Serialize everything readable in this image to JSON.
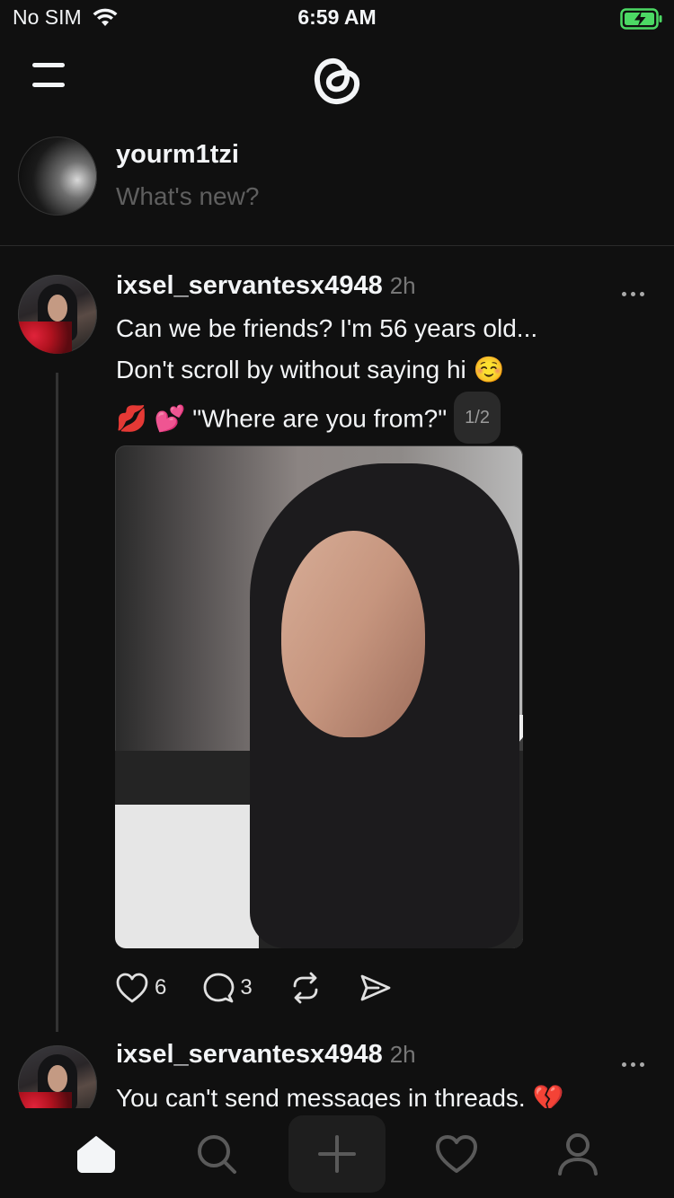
{
  "status_bar": {
    "carrier": "No SIM",
    "time": "6:59 AM"
  },
  "composer": {
    "username": "yourm1tzi",
    "placeholder": "What's new?"
  },
  "posts": [
    {
      "username": "ixsel_servantesx4948",
      "time": "2h",
      "line1": "Can we be friends? I'm 56 years old...",
      "line2": "Don't scroll by without saying hi ☺️",
      "line3": "💋  💕  \"Where are you from?\"",
      "page_indicator": "1/2",
      "likes": "6",
      "replies": "3"
    },
    {
      "username": "ixsel_servantesx4948",
      "time": "2h",
      "line1": "You can't send messages in threads. 💔"
    }
  ],
  "colors": {
    "background": "#101010",
    "text": "#f3f5f7",
    "muted": "#777777",
    "battery": "#4cd964"
  },
  "icons": {
    "header": [
      "menu-icon",
      "threads-logo"
    ],
    "actions": [
      "heart-icon",
      "comment-icon",
      "repost-icon",
      "share-icon"
    ],
    "tabs": [
      "home-icon",
      "search-icon",
      "new-thread-icon",
      "activity-icon",
      "profile-icon"
    ]
  }
}
